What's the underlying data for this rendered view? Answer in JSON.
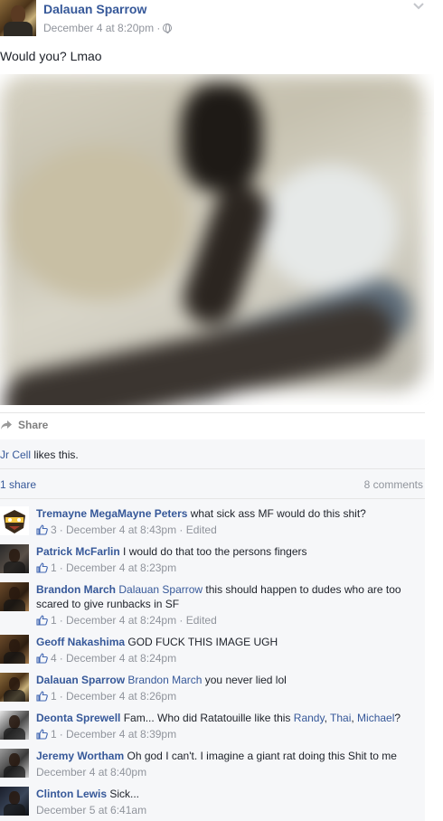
{
  "post": {
    "author": "Dalauan Sparrow",
    "timestamp": "December 4 at 8:20pm · ",
    "audience_icon": "globe-icon",
    "menu_icon": "chevron-down-icon",
    "text": "Would you? Lmao"
  },
  "actions": {
    "share_label": "Share",
    "share_icon": "share-arrow-icon"
  },
  "ufi": {
    "liker": "Jr Cell",
    "likes_suffix": " likes this.",
    "shares": "1 share",
    "comments_count": "8 comments"
  },
  "comments": [
    {
      "author": "Tremayne MegaMayne Peters",
      "text": " what sick ass MF would do this shit?",
      "likes": "3",
      "time": " · December 4 at 8:43pm · Edited"
    },
    {
      "author": "Patrick McFarlin",
      "text": " I would do that too the persons fingers",
      "likes": "1",
      "time": " · December 4 at 8:23pm"
    },
    {
      "author": "Brandon March",
      "mention": "Dalauan Sparrow",
      "text": " this should happen to dudes who are too scared to give runbacks in SF",
      "likes": "1",
      "time": " · December 4 at 8:24pm · Edited"
    },
    {
      "author": "Geoff Nakashima",
      "text": " GOD FUCK THIS IMAGE UGH",
      "likes": "4",
      "time": " · December 4 at 8:24pm"
    },
    {
      "author": "Dalauan Sparrow",
      "mention": "Brandon March",
      "text": " you never lied lol",
      "likes": "1",
      "time": " · December 4 at 8:26pm"
    },
    {
      "author": "Deonta Sprewell",
      "text": " Fam... Who did Ratatouille like this ",
      "tags": [
        "Randy",
        "Thai",
        "Michael"
      ],
      "tag_sep": ", ",
      "text_end": "?",
      "likes": "1",
      "time": " · December 4 at 8:39pm"
    },
    {
      "author": "Jeremy Wortham",
      "text": " Oh god I can't. I imagine a giant rat doing this Shit to me",
      "time": "December 4 at 8:40pm"
    },
    {
      "author": "Clinton Lewis",
      "text": " Sick...",
      "time": "December 5 at 6:41am"
    }
  ],
  "colors": {
    "link": "#365899",
    "meta": "#90949c",
    "ufi_bg": "#f6f7f9"
  }
}
